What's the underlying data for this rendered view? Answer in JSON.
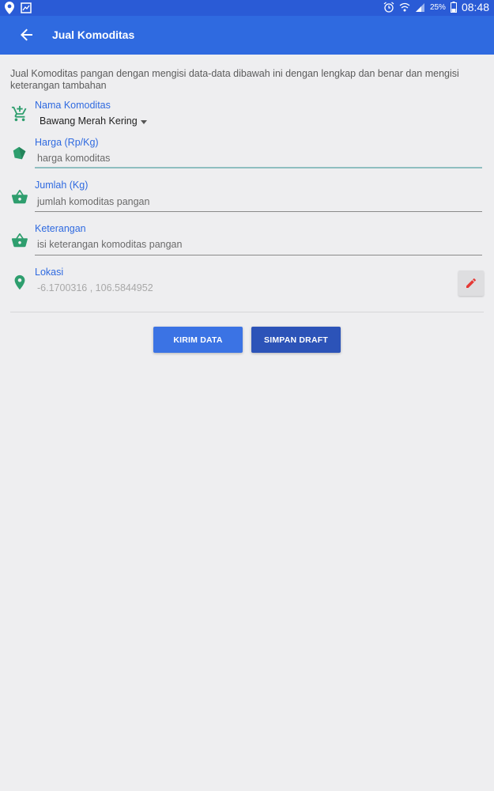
{
  "status_bar": {
    "battery_percent": "25%",
    "time": "08:48",
    "icons": [
      "location-icon",
      "image-icon",
      "alarm-icon",
      "wifi-icon",
      "signal-icon",
      "battery-icon"
    ]
  },
  "app_bar": {
    "title": "Jual Komoditas",
    "back_icon": "arrow-back-icon"
  },
  "intro_text": "Jual Komoditas pangan dengan mengisi data-data dibawah ini dengan lengkap dan benar dan mengisi keterangan tambahan",
  "form": {
    "nama_komoditas": {
      "label": "Nama Komoditas",
      "selected": "Bawang Merah Kering",
      "icon": "cart-add-icon"
    },
    "harga": {
      "label": "Harga (Rp/Kg)",
      "placeholder": "harga komoditas",
      "icon": "tag-icon"
    },
    "jumlah": {
      "label": "Jumlah (Kg)",
      "placeholder": "jumlah komoditas pangan",
      "icon": "basket-icon"
    },
    "keterangan": {
      "label": "Keterangan",
      "placeholder": "isi keterangan komoditas pangan",
      "icon": "basket-icon"
    },
    "lokasi": {
      "label": "Lokasi",
      "value": "-6.1700316 , 106.5844952",
      "icon": "location-pin-icon",
      "edit_icon": "pencil-icon"
    }
  },
  "buttons": {
    "kirim": "KIRIM DATA",
    "draft": "SIMPAN DRAFT"
  },
  "colors": {
    "status_bar": "#2a5bd6",
    "app_bar": "#2f6ae0",
    "label": "#2f6ae0",
    "icon_green": "#2e9e6e",
    "edit_red": "#e53935",
    "background": "#eeeef0"
  }
}
